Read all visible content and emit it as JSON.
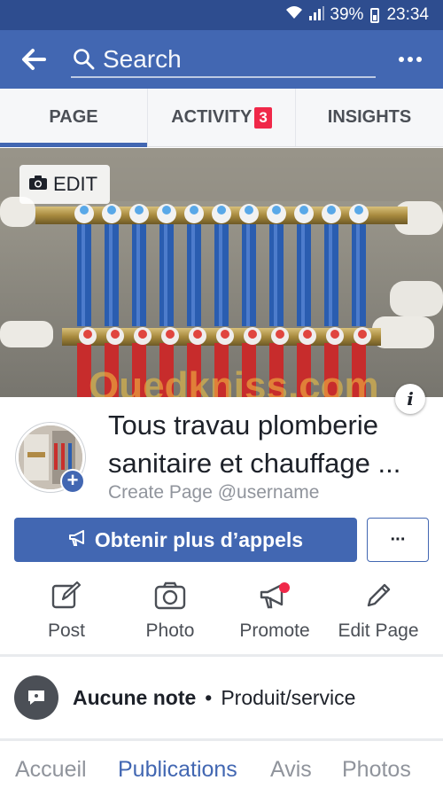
{
  "status_bar": {
    "battery": "39%",
    "time": "23:34"
  },
  "header": {
    "search_placeholder": "Search"
  },
  "tabs": [
    {
      "label": "PAGE",
      "active": true
    },
    {
      "label": "ACTIVITY",
      "badge": "3"
    },
    {
      "label": "INSIGHTS"
    }
  ],
  "cover": {
    "edit_label": "EDIT",
    "watermark": "Ouedkniss.com"
  },
  "page": {
    "title": "Tous travau plomberie sanitaire et chauffage ...",
    "username_prompt": "Create Page @username"
  },
  "cta": {
    "label": "Obtenir plus d’appels",
    "more": "···"
  },
  "actions": [
    {
      "label": "Post",
      "icon": "edit-square-icon"
    },
    {
      "label": "Photo",
      "icon": "camera-icon"
    },
    {
      "label": "Promote",
      "icon": "megaphone-icon"
    },
    {
      "label": "Edit Page",
      "icon": "pencil-icon"
    }
  ],
  "info": {
    "rating": "Aucune note",
    "separator": "•",
    "category": "Produit/service"
  },
  "bottom_nav": [
    {
      "label": "Accueil"
    },
    {
      "label": "Publications",
      "active": true
    },
    {
      "label": "Avis"
    },
    {
      "label": "Photos"
    }
  ],
  "colors": {
    "brand": "#4267b2",
    "status_bar": "#2e4d8f",
    "badge": "#f02849"
  }
}
